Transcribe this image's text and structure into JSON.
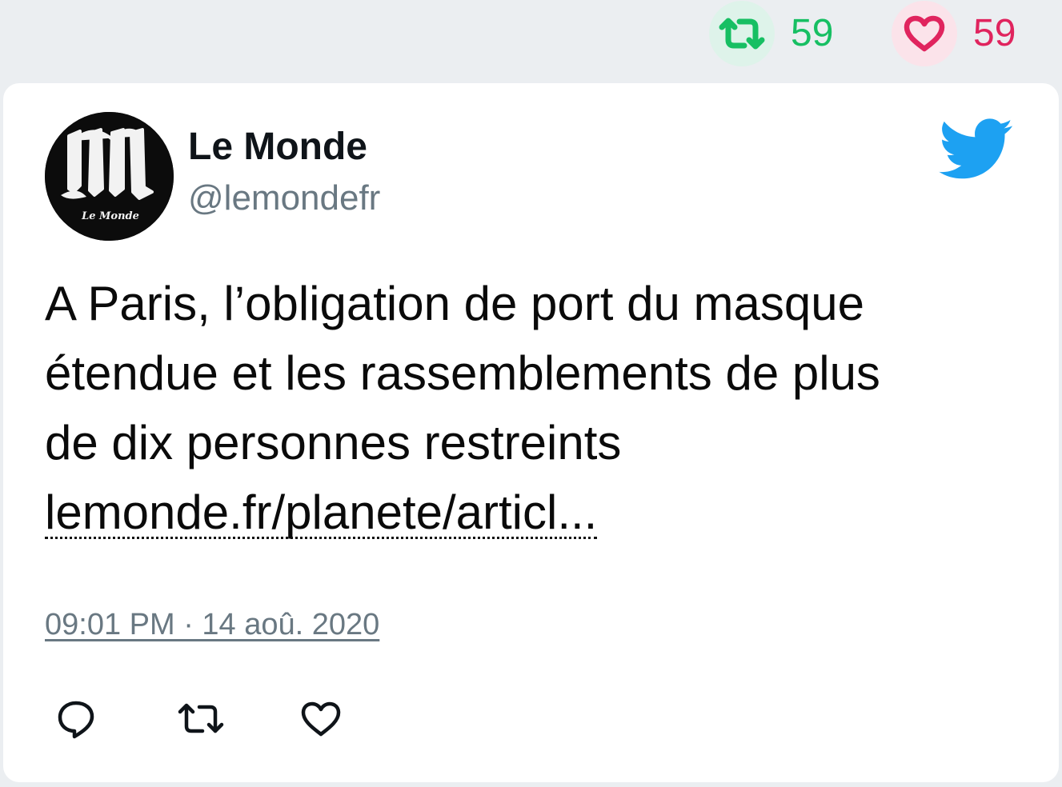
{
  "stats": {
    "retweet_count": "59",
    "like_count": "59",
    "retweet_color": "#17bf63",
    "like_color": "#e0245e"
  },
  "author": {
    "name": "Le Monde",
    "handle": "@lemondefr",
    "avatar_icon": "le-monde-logo-icon",
    "avatar_logo_text": "Le Monde"
  },
  "tweet": {
    "text_lines": [
      "A Paris, l’obligation de port du masque",
      "étendue et les rassemblements de plus",
      "de dix personnes restreints"
    ],
    "link_text": "lemonde.fr/planete/articl...",
    "timestamp": "09:01 PM · 14 aoû. 2020"
  },
  "icons": {
    "brand": "twitter-bird-icon",
    "reply": "reply-icon",
    "retweet": "retweet-icon",
    "like": "heart-icon"
  },
  "colors": {
    "twitter_blue": "#1da1f2",
    "secondary_text": "#697882"
  }
}
